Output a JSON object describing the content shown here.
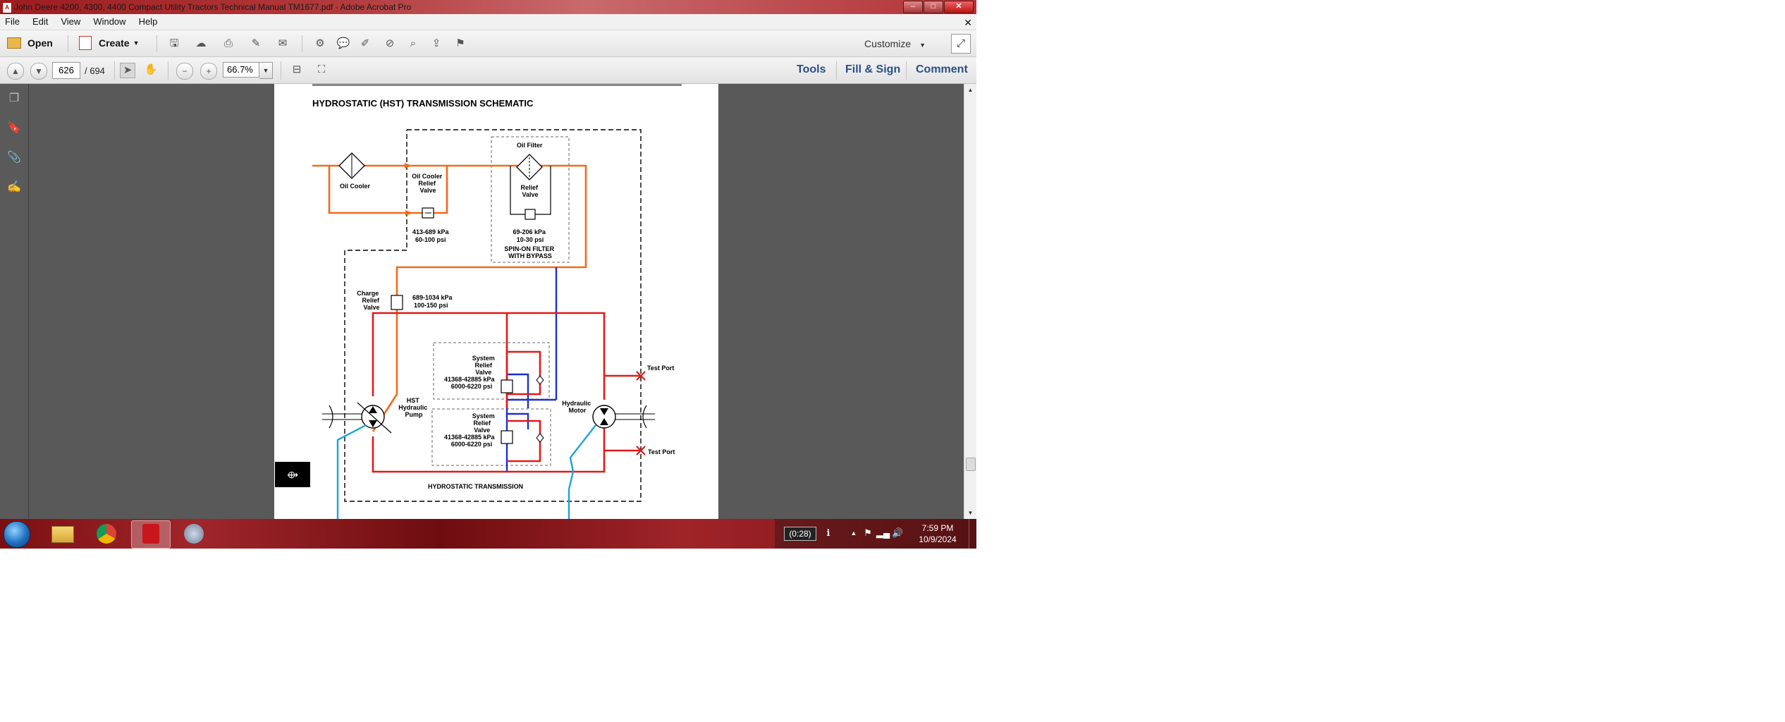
{
  "window": {
    "title": "John Deere 4200, 4300, 4400 Compact Utility Tractors Technical Manual TM1677.pdf - Adobe Acrobat Pro",
    "app_icon_label": "A",
    "minimize": "–",
    "maximize": "□",
    "close": "✕"
  },
  "menu": {
    "items": [
      "File",
      "Edit",
      "View",
      "Window",
      "Help"
    ],
    "close_glyph": "✕"
  },
  "toolbar": {
    "open_label": "Open",
    "create_label": "Create",
    "customize_label": "Customize"
  },
  "nav": {
    "page_current": "626",
    "page_total": "/ 694",
    "zoom": "66.7%"
  },
  "panels": {
    "tools": "Tools",
    "fill_sign": "Fill & Sign",
    "comment": "Comment"
  },
  "document": {
    "heading": "HYDROSTATIC (HST) TRANSMISSION SCHEMATIC",
    "labels": {
      "oil_cooler": "Oil Cooler",
      "oil_cooler_relief": [
        "Oil Cooler",
        "Relief",
        "Valve"
      ],
      "cooler_pressure": [
        "413-689 kPa",
        "60-100 psi"
      ],
      "oil_filter": "Oil Filter",
      "filter_relief": [
        "Relief",
        "Valve"
      ],
      "filter_pressure": [
        "69-206 kPa",
        "10-30 psi"
      ],
      "spin_on": [
        "SPIN-ON FILTER",
        "WITH BYPASS"
      ],
      "charge_relief": [
        "Charge",
        "Relief",
        "Valve"
      ],
      "charge_pressure": [
        "689-1034 kPa",
        "100-150 psi"
      ],
      "system_relief_1": [
        "System",
        "Relief",
        "Valve",
        "41368-42885 kPa",
        "6000-6220 psi"
      ],
      "system_relief_2": [
        "System",
        "Relief",
        "Valve",
        "41368-42885 kPa",
        "6000-6220 psi"
      ],
      "hst_pump": [
        "HST",
        "Hydraulic",
        "Pump"
      ],
      "hyd_motor": [
        "Hydraulic",
        "Motor"
      ],
      "test_port_1": "Test Port",
      "test_port_2": "Test Port",
      "hst_transmission": "HYDROSTATIC TRANSMISSION"
    },
    "side_tab_glyph": "⟴",
    "colors": {
      "charge_line": "#f26a1b",
      "pressure_line": "#e01b1b",
      "return_line": "#1f2fd1",
      "suction_line": "#1aa3e0"
    }
  },
  "taskbar": {
    "battery": "(0:28)",
    "time": "7:59 PM",
    "date": "10/9/2024"
  }
}
